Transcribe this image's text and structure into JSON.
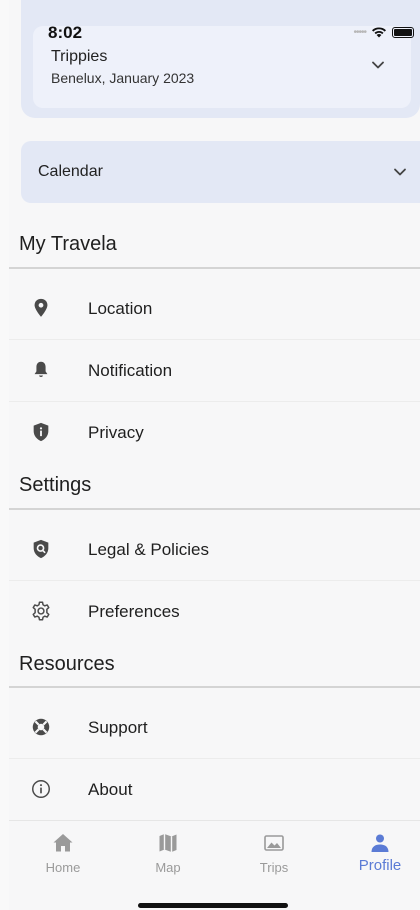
{
  "status_bar": {
    "time": "8:02"
  },
  "trip_selector": {
    "title": "Trippies",
    "subtitle": "Benelux, January 2023"
  },
  "calendar": {
    "label": "Calendar"
  },
  "sections": [
    {
      "heading": "My Travela",
      "items": [
        {
          "label": "Location",
          "icon": "location-pin-icon"
        },
        {
          "label": "Notification",
          "icon": "bell-icon"
        },
        {
          "label": "Privacy",
          "icon": "shield-info-icon"
        }
      ]
    },
    {
      "heading": "Settings",
      "items": [
        {
          "label": "Legal & Policies",
          "icon": "shield-search-icon"
        },
        {
          "label": "Preferences",
          "icon": "gear-icon"
        }
      ]
    },
    {
      "heading": "Resources",
      "items": [
        {
          "label": "Support",
          "icon": "life-ring-icon"
        },
        {
          "label": "About",
          "icon": "info-circle-icon"
        }
      ]
    }
  ],
  "tabs": [
    {
      "label": "Home",
      "icon": "home-icon",
      "active": false
    },
    {
      "label": "Map",
      "icon": "map-icon",
      "active": false
    },
    {
      "label": "Trips",
      "icon": "image-icon",
      "active": false
    },
    {
      "label": "Profile",
      "icon": "person-icon",
      "active": true
    }
  ],
  "colors": {
    "accent": "#5b7bd5",
    "card_background": "#e3e8f5",
    "inactive_tab": "#9a9a9a"
  }
}
